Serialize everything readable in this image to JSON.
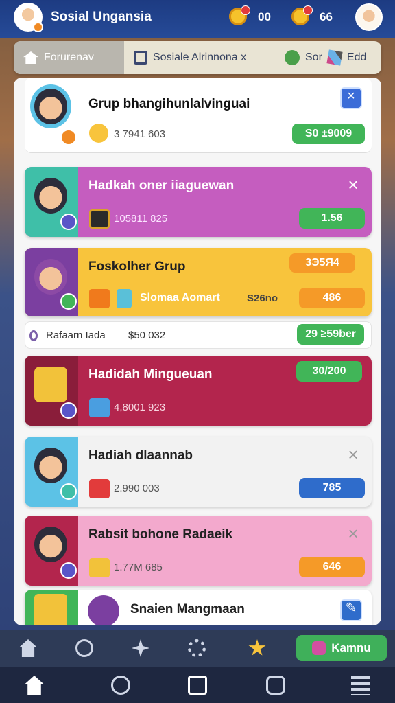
{
  "header": {
    "app_title": "Sosial Ungansia",
    "counters": [
      "00",
      "66"
    ]
  },
  "tabs": [
    {
      "label": "Forurenav",
      "active": true
    },
    {
      "label": "Sosiale Alrinnona x"
    },
    {
      "label": "Sor"
    },
    {
      "label": "Edd"
    }
  ],
  "cards": [
    {
      "title": "Grup bhangihunlalvinguai",
      "sub": "3 7941 603",
      "pill": "S0 ±9009",
      "pill_color": "#41b558",
      "bg": "#ffffff"
    },
    {
      "title": "Hadkah oner iiaguewan",
      "sub": "105811 825",
      "pill": "1.56",
      "pill_color": "#41b558",
      "bg": "#c55dbf"
    },
    {
      "title": "Foskolher Grup",
      "tag": "3Э5Я4",
      "sub": "Slomaa Aomart",
      "sub2": "S26no",
      "pill": "486",
      "pill_color": "#f59a28",
      "bg": "#f8c43c"
    },
    {
      "title": "Hadidah Mingueuan",
      "sub": "4,8001 923",
      "pill": "30/200",
      "pill_color": "#41b558",
      "bg": "#b3254d"
    },
    {
      "title": "Hadiah dlaannab",
      "sub": "2.990 003",
      "pill": "785",
      "pill_color": "#2f6ccb",
      "bg": "#f2f2f2"
    },
    {
      "title": "Rabsit bohone Radaeik",
      "sub": "1.77M 685",
      "pill": "646",
      "pill_color": "#f59a28",
      "bg": "#f3a9cd"
    },
    {
      "title": "Snaien Mangmaan",
      "bg": "#ffffff"
    }
  ],
  "thin_row": {
    "label": "Rafaarn Iada",
    "value": "$50 032",
    "pill": "29 ≥59ber"
  },
  "nav": {
    "kamnu": "Kamnu"
  },
  "colors": {
    "accent": "#2f6ccb",
    "green": "#41b558",
    "topbar": "#1d3b82"
  }
}
